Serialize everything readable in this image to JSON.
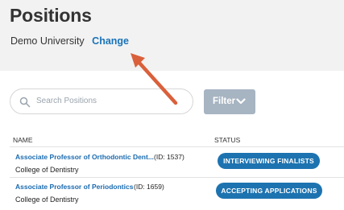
{
  "header": {
    "title": "Positions",
    "organization": "Demo University",
    "change_label": "Change"
  },
  "search": {
    "placeholder": "Search Positions",
    "icon": "search-icon"
  },
  "filter": {
    "label": "Filter",
    "icon": "chevron-down-icon"
  },
  "table": {
    "columns": [
      "NAME",
      "STATUS"
    ],
    "rows": [
      {
        "title": "Associate Professor of Orthodontic Dent...",
        "id": "(ID: 1537)",
        "department": "College of Dentistry",
        "status": "INTERVIEWING FINALISTS"
      },
      {
        "title": "Associate Professor of Periodontics",
        "id": "(ID: 1659)",
        "department": "College of Dentistry",
        "status": "ACCEPTING APPLICATIONS"
      }
    ]
  },
  "colors": {
    "link": "#1a73b8",
    "status_badge": "#1d73b0",
    "filter_button": "#a7b4c2",
    "annotation_arrow": "#d9603b"
  }
}
